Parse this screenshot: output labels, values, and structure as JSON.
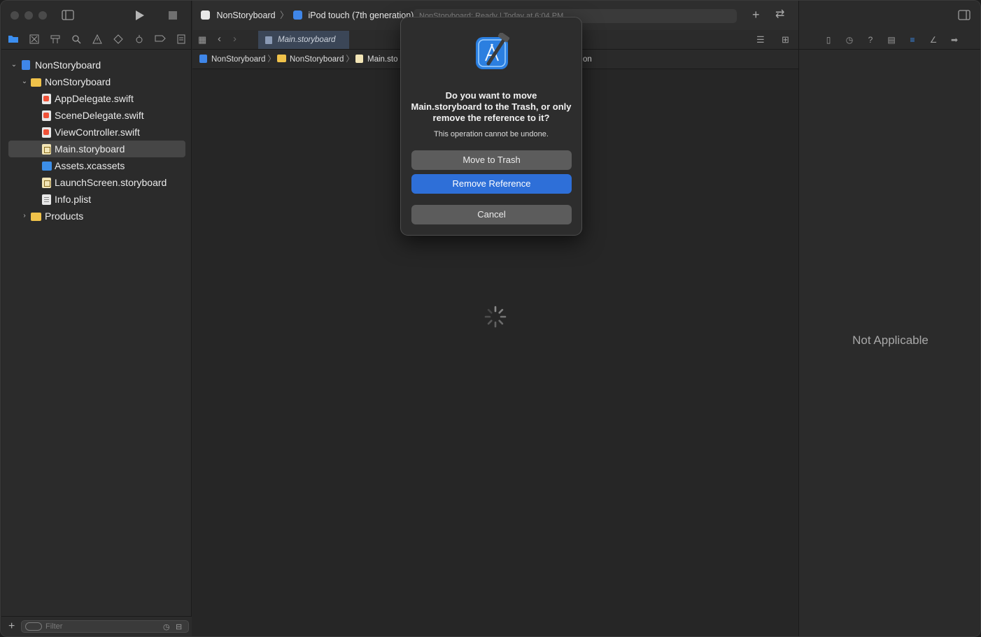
{
  "navigator": {
    "tree": [
      {
        "label": "NonStoryboard",
        "kind": "project",
        "level": 0,
        "expanded": true
      },
      {
        "label": "NonStoryboard",
        "kind": "folder",
        "level": 1,
        "expanded": true
      },
      {
        "label": "AppDelegate.swift",
        "kind": "swift",
        "level": 2
      },
      {
        "label": "SceneDelegate.swift",
        "kind": "swift",
        "level": 2
      },
      {
        "label": "ViewController.swift",
        "kind": "swift",
        "level": 2
      },
      {
        "label": "Main.storyboard",
        "kind": "storyboard",
        "level": 2,
        "selected": true
      },
      {
        "label": "Assets.xcassets",
        "kind": "assets",
        "level": 2
      },
      {
        "label": "LaunchScreen.storyboard",
        "kind": "storyboard",
        "level": 2
      },
      {
        "label": "Info.plist",
        "kind": "plist",
        "level": 2
      },
      {
        "label": "Products",
        "kind": "folder",
        "level": 1,
        "expanded": false
      }
    ],
    "filter_placeholder": "Filter"
  },
  "toolbar": {
    "scheme": "NonStoryboard",
    "destination": "iPod touch (7th generation)",
    "activity_status": "NonStoryboard: Ready | Today at 6:04 PM"
  },
  "editor": {
    "active_tab": "Main.storyboard",
    "jump_bar": [
      "NonStoryboard",
      "NonStoryboard",
      "Main.sto",
      "on"
    ]
  },
  "inspector": {
    "empty_message": "Not Applicable"
  },
  "dialog": {
    "title": "Do you want to move Main.storyboard to the Trash, or only remove the reference to it?",
    "subtitle": "This operation cannot be undone.",
    "buttons": {
      "trash": "Move to Trash",
      "remove": "Remove Reference",
      "cancel": "Cancel"
    }
  },
  "colors": {
    "accent": "#2e6fd8",
    "selection": "#464646",
    "background": "#262626"
  }
}
